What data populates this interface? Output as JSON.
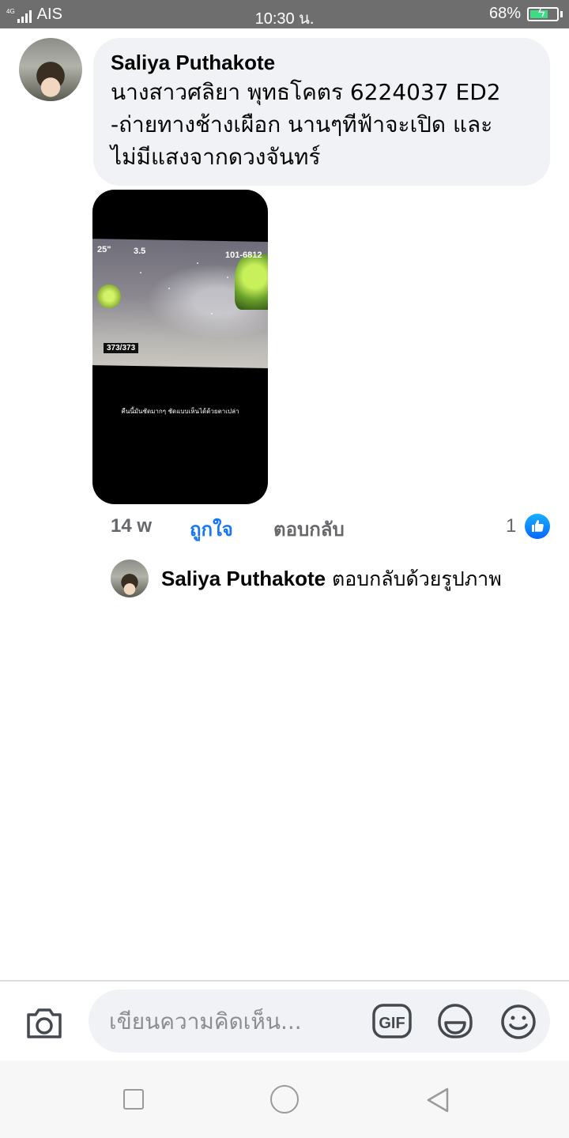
{
  "status_bar": {
    "network": "4G",
    "carrier": "AIS",
    "time": "10:30 น.",
    "battery_percent": "68%",
    "battery_level": 0.68
  },
  "comment": {
    "author": "Saliya Puthakote",
    "text": "นางสาวศลิยา พุทธโคตร 6224037 ED2 -ถ่ายทางช้างเผือก นานๆทีฟ้าจะเปิด และไม่มีแสงจากดวงจันทร์",
    "photo": {
      "hud_left": "25\"",
      "hud_mid": "3.5",
      "hud_right": "101-6812",
      "counter": "373/373",
      "caption": "คืนนี้มันชัดมากๆ ชัดแบบเห็นได้ด้วยตาเปล่า"
    },
    "time_ago": "14 w",
    "like_label": "ถูกใจ",
    "reply_label": "ตอบกลับ",
    "reaction_count": "1",
    "reaction_icon": "thumbs-up-icon"
  },
  "reply_summary": {
    "author": "Saliya Puthakote",
    "text": " ตอบกลับด้วยรูปภาพ"
  },
  "composer": {
    "placeholder": "เขียนความคิดเห็น...",
    "icons": [
      "camera-icon",
      "gif-icon",
      "sticker-icon",
      "emoji-icon"
    ]
  },
  "colors": {
    "accent": "#1877f2",
    "bubble": "#f0f2f5",
    "status_bar": "#6e6e6e",
    "secondary_text": "#65676b"
  }
}
